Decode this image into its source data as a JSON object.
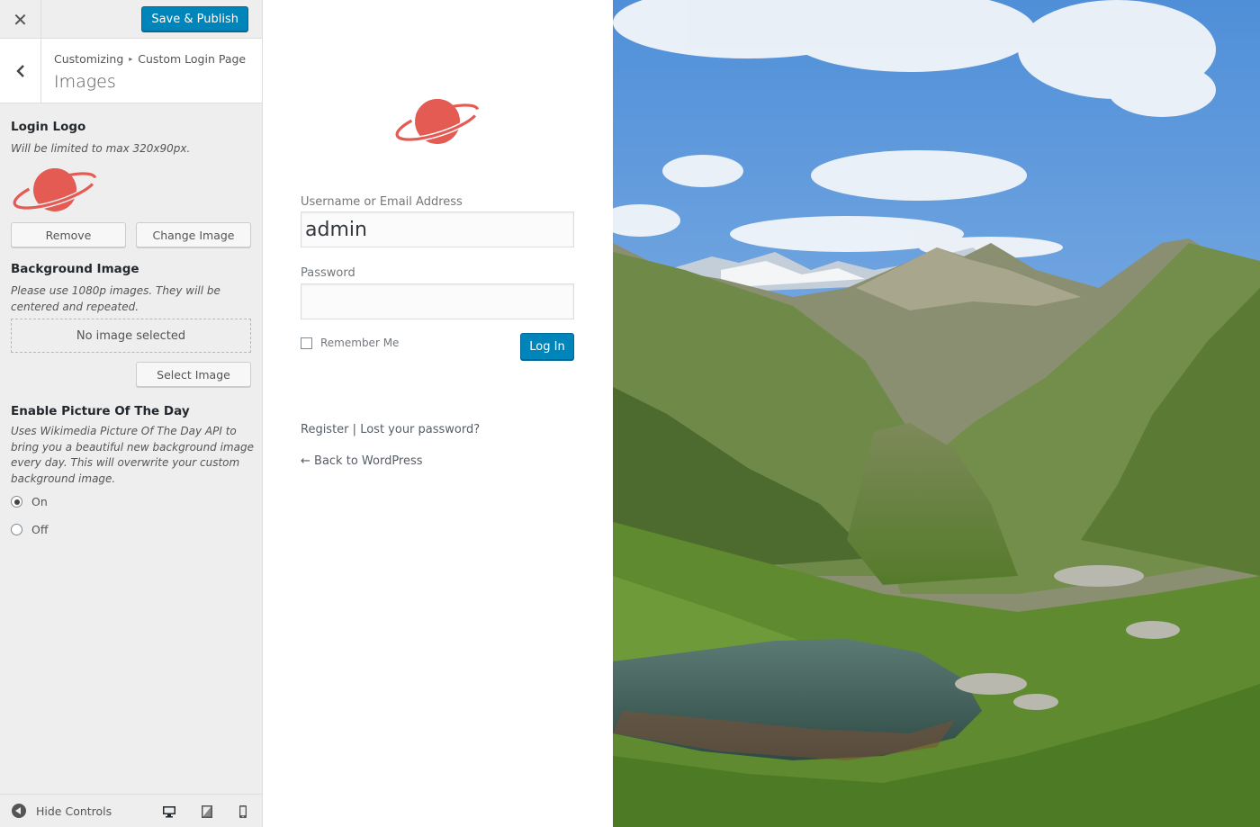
{
  "topbar": {
    "close_glyph": "✕",
    "publish_label": "Save & Publish",
    "colors": {
      "primary": "#0085ba"
    }
  },
  "section": {
    "breadcrumb_root": "Customizing",
    "breadcrumb_sep": "▸",
    "breadcrumb_current": "Custom Login Page",
    "title": "Images",
    "back_glyph": "‹"
  },
  "controls": {
    "logo": {
      "title": "Login Logo",
      "desc": "Will be limited to max 320x90px.",
      "remove_label": "Remove",
      "change_label": "Change Image",
      "logo_icon": "planet-icon",
      "logo_color": "#e35b53"
    },
    "background": {
      "title": "Background Image",
      "desc": "Please use 1080p images. They will be centered and repeated.",
      "placeholder": "No image selected",
      "select_label": "Select Image"
    },
    "potd": {
      "title": "Enable Picture Of The Day",
      "desc": "Uses Wikimedia Picture Of The Day API to bring you a beautiful new background image every day. This will overwrite your custom background image.",
      "options": [
        {
          "label": "On",
          "checked": true
        },
        {
          "label": "Off",
          "checked": false
        }
      ]
    }
  },
  "footer": {
    "hide_label": "Hide Controls",
    "devices": [
      "desktop-icon",
      "tablet-icon",
      "mobile-icon"
    ]
  },
  "login": {
    "username_label": "Username or Email Address",
    "username_value": "admin",
    "password_label": "Password",
    "password_value": "",
    "remember_label": "Remember Me",
    "login_label": "Log In",
    "register_link": "Register",
    "link_sep": "|",
    "lost_link": "Lost your password?",
    "back_link": "← Back to WordPress"
  }
}
